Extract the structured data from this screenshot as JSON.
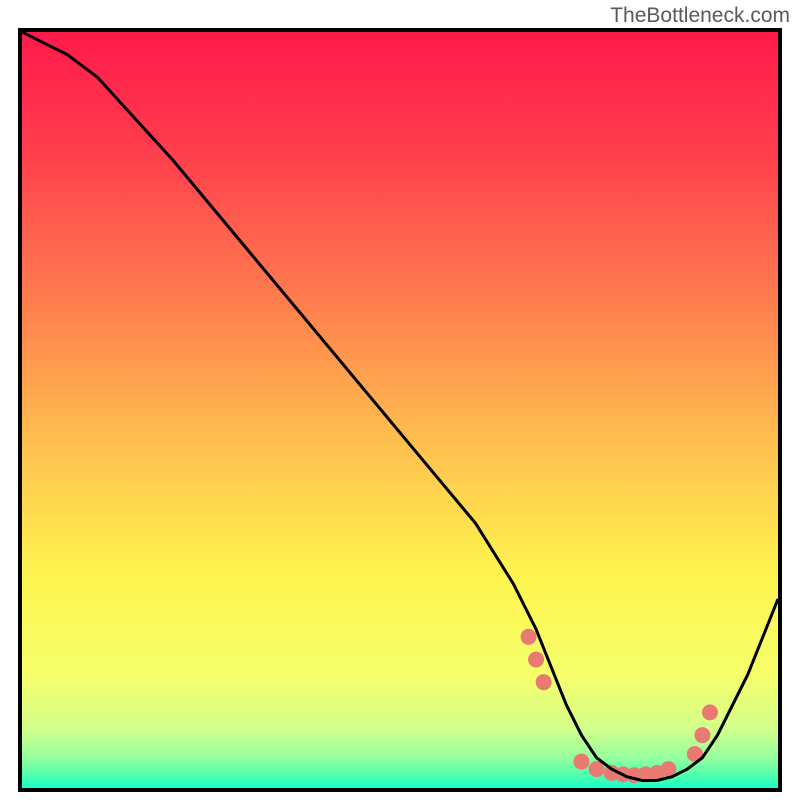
{
  "watermark": "TheBottleneck.com",
  "chart_data": {
    "type": "line",
    "title": "",
    "xlabel": "",
    "ylabel": "",
    "xlim": [
      0,
      100
    ],
    "ylim": [
      0,
      100
    ],
    "series": [
      {
        "name": "bottleneck-curve",
        "x": [
          0,
          2,
          6,
          10,
          20,
          30,
          40,
          50,
          60,
          65,
          68,
          70,
          72,
          74,
          76,
          78,
          80,
          82,
          84,
          86,
          88,
          90,
          92,
          96,
          100
        ],
        "y": [
          100,
          99,
          97,
          94,
          83,
          71,
          59,
          47,
          35,
          27,
          21,
          16,
          11,
          7,
          4,
          2.5,
          1.5,
          1,
          1,
          1.5,
          2.5,
          4,
          7,
          15,
          25
        ]
      }
    ],
    "markers": {
      "name": "highlight-dots",
      "color": "#e87a72",
      "points": [
        {
          "x": 67,
          "y": 20
        },
        {
          "x": 68,
          "y": 17
        },
        {
          "x": 69,
          "y": 14
        },
        {
          "x": 74,
          "y": 3.5
        },
        {
          "x": 76,
          "y": 2.5
        },
        {
          "x": 78,
          "y": 2
        },
        {
          "x": 79.5,
          "y": 1.8
        },
        {
          "x": 81,
          "y": 1.7
        },
        {
          "x": 82.5,
          "y": 1.8
        },
        {
          "x": 84,
          "y": 2
        },
        {
          "x": 85.5,
          "y": 2.5
        },
        {
          "x": 89,
          "y": 4.5
        },
        {
          "x": 90,
          "y": 7
        },
        {
          "x": 91,
          "y": 10
        }
      ]
    },
    "gradient": {
      "stops": [
        {
          "offset": 0,
          "color": "#ff1a4a"
        },
        {
          "offset": 0.15,
          "color": "#ff3c4d"
        },
        {
          "offset": 0.35,
          "color": "#ff7b4e"
        },
        {
          "offset": 0.55,
          "color": "#ffc24f"
        },
        {
          "offset": 0.72,
          "color": "#fff54f"
        },
        {
          "offset": 0.85,
          "color": "#f5ff6a"
        },
        {
          "offset": 0.92,
          "color": "#d4ff8a"
        },
        {
          "offset": 0.96,
          "color": "#96ff9e"
        },
        {
          "offset": 0.985,
          "color": "#4affb0"
        },
        {
          "offset": 1.0,
          "color": "#1affc8"
        }
      ]
    }
  }
}
